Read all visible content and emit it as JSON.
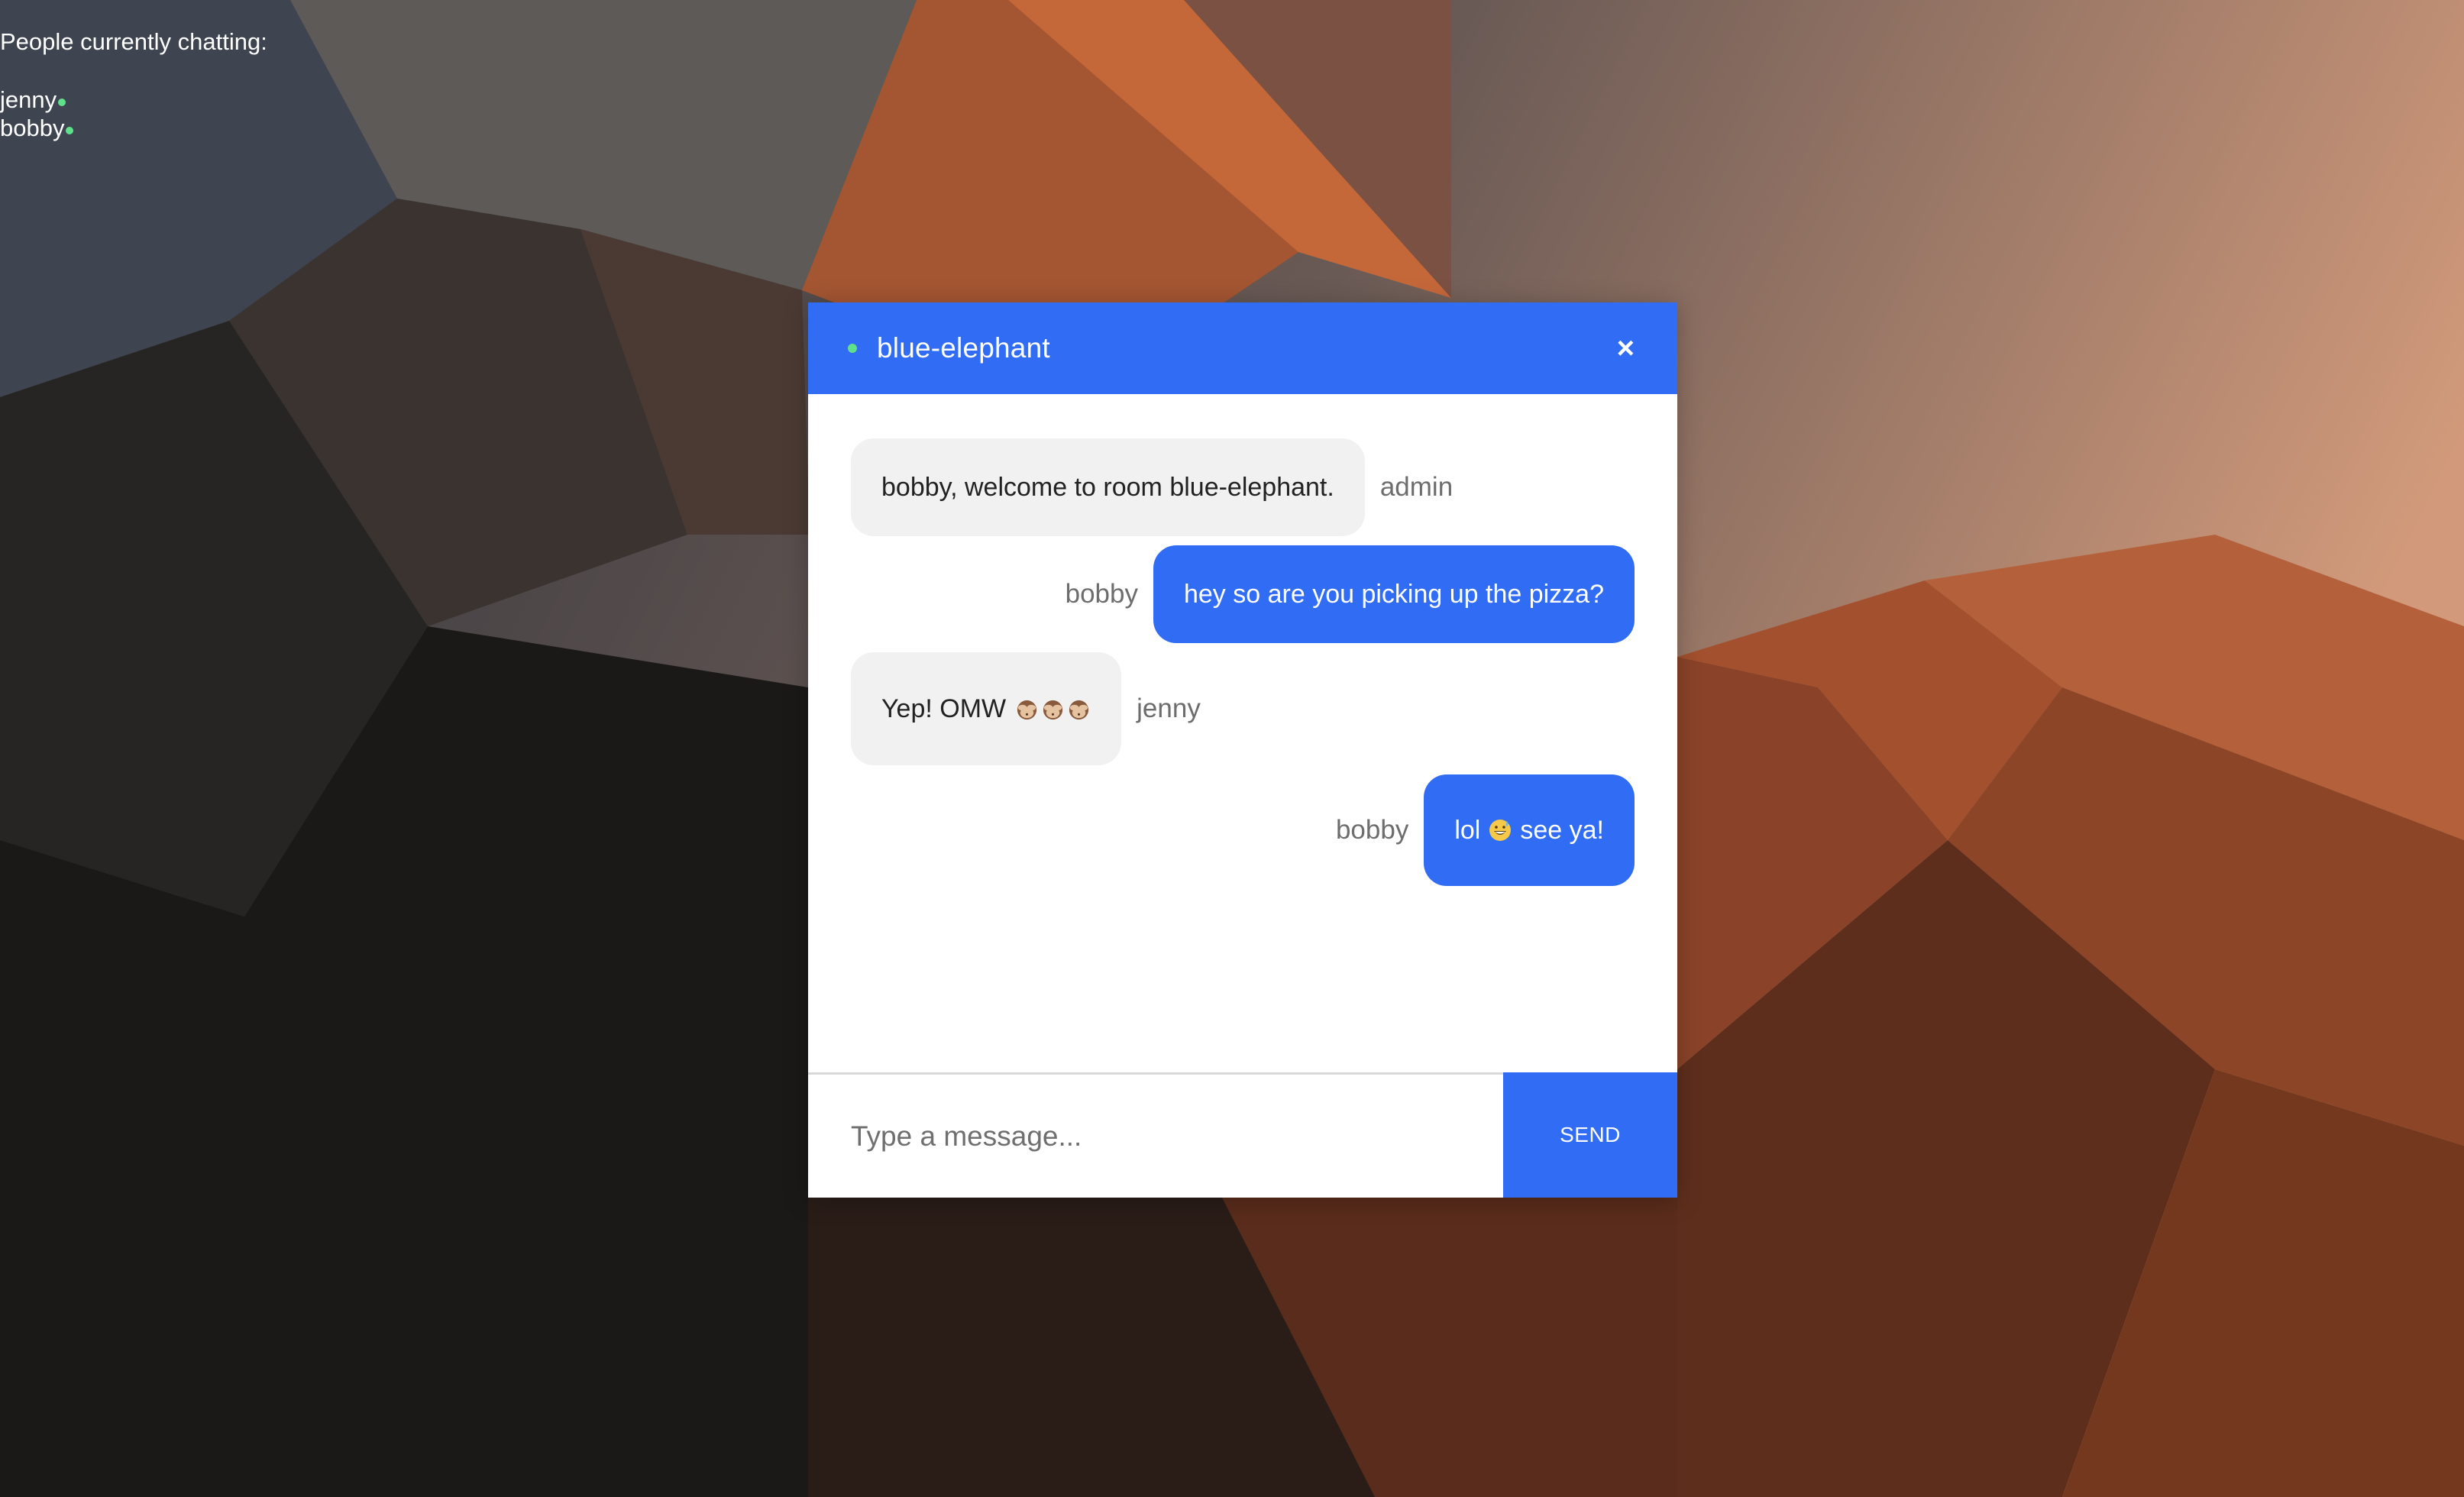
{
  "colors": {
    "accent": "#316cf4",
    "online": "#5fe08a",
    "incoming_bubble": "#f1f1f1",
    "sender_text": "#6d6d6d"
  },
  "online_panel": {
    "heading": "People currently chatting:",
    "users": [
      {
        "name": "jenny",
        "status_icon": "online-dot"
      },
      {
        "name": "bobby",
        "status_icon": "online-dot"
      }
    ]
  },
  "chat": {
    "room_name": "blue-elephant",
    "close_label": "×",
    "messages": [
      {
        "direction": "incoming",
        "sender": "admin",
        "text": "bobby, welcome to room blue-elephant."
      },
      {
        "direction": "outgoing",
        "sender": "bobby",
        "text": "hey so are you picking up the pizza?"
      },
      {
        "direction": "incoming",
        "sender": "jenny",
        "text": "Yep! OMW",
        "emoji": [
          "see-no-evil-monkey",
          "see-no-evil-monkey",
          "see-no-evil-monkey"
        ]
      },
      {
        "direction": "outgoing",
        "sender": "bobby",
        "text_before": "lol",
        "emoji": "grinning-sweat-face",
        "text_after": "see ya!"
      }
    ],
    "composer": {
      "placeholder": "Type a message...",
      "send_label": "SEND"
    }
  }
}
